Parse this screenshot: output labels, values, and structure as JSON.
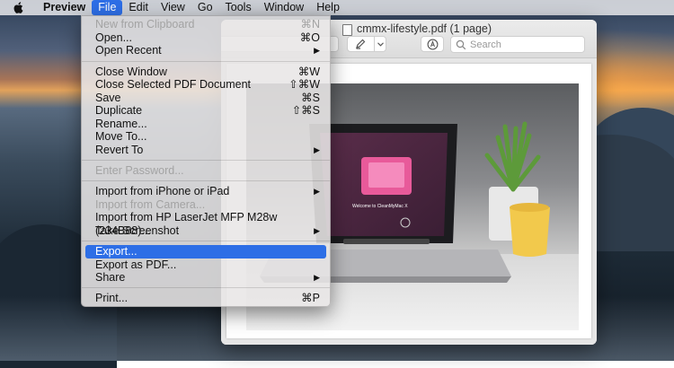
{
  "menubar": {
    "app_name": "Preview",
    "items": [
      "File",
      "Edit",
      "View",
      "Go",
      "Tools",
      "Window",
      "Help"
    ]
  },
  "window": {
    "title": "cmmx-lifestyle.pdf (1 page)",
    "search_placeholder": "Search"
  },
  "photo": {
    "laptop_screen_text": "Welcome to CleanMyMac X"
  },
  "file_menu": {
    "new_from_clipboard": {
      "label": "New from Clipboard",
      "shortcut": "⌘N"
    },
    "open": {
      "label": "Open...",
      "shortcut": "⌘O"
    },
    "open_recent": {
      "label": "Open Recent",
      "submenu": "▶"
    },
    "close_window": {
      "label": "Close Window",
      "shortcut": "⌘W"
    },
    "close_selected": {
      "label": "Close Selected PDF Document",
      "shortcut": "⇧⌘W"
    },
    "save": {
      "label": "Save",
      "shortcut": "⌘S"
    },
    "duplicate": {
      "label": "Duplicate",
      "shortcut": "⇧⌘S"
    },
    "rename": {
      "label": "Rename..."
    },
    "move_to": {
      "label": "Move To..."
    },
    "revert_to": {
      "label": "Revert To",
      "submenu": "▶"
    },
    "enter_password": {
      "label": "Enter Password..."
    },
    "import_iphone": {
      "label": "Import from iPhone or iPad",
      "submenu": "▶"
    },
    "import_camera": {
      "label": "Import from Camera..."
    },
    "import_hp": {
      "label": "Import from HP LaserJet MFP M28w (234B88)..."
    },
    "take_screenshot": {
      "label": "Take Screenshot",
      "submenu": "▶"
    },
    "export": {
      "label": "Export..."
    },
    "export_pdf": {
      "label": "Export as PDF..."
    },
    "share": {
      "label": "Share",
      "submenu": "▶"
    },
    "print": {
      "label": "Print...",
      "shortcut": "⌘P"
    }
  },
  "colors": {
    "highlight": "#2d6ee6",
    "menu_bg": "#e8e6e6",
    "disabled_text": "#a3a3a3"
  }
}
